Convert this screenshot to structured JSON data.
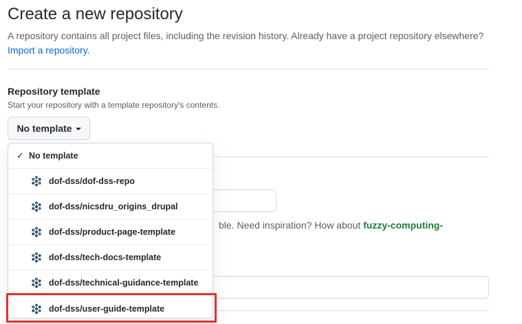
{
  "page": {
    "title": "Create a new repository",
    "description": "A repository contains all project files, including the revision history. Already have a project repository elsewhere?",
    "import_link": "Import a repository"
  },
  "template_section": {
    "label": "Repository template",
    "note": "Start your repository with a template repository's contents.",
    "button_label": "No template"
  },
  "background": {
    "inspiration_text": "ble. Need inspiration? How about ",
    "inspiration_suggestion": "fuzzy-computing-"
  },
  "menu": {
    "items": [
      {
        "label": "No template",
        "selected": true
      },
      {
        "label": "dof-dss/dof-dss-repo",
        "icon": "org-avatar-icon"
      },
      {
        "label": "dof-dss/nicsdru_origins_drupal",
        "icon": "org-avatar-icon"
      },
      {
        "label": "dof-dss/product-page-template",
        "icon": "org-avatar-icon"
      },
      {
        "label": "dof-dss/tech-docs-template",
        "icon": "org-avatar-icon"
      },
      {
        "label": "dof-dss/technical-guidance-template",
        "icon": "org-avatar-icon"
      },
      {
        "label": "dof-dss/user-guide-template",
        "icon": "org-avatar-icon",
        "highlighted": true
      }
    ]
  },
  "colors": {
    "link": "#0969da",
    "suggestion": "#1a7f37",
    "highlight_border": "#e5302a"
  }
}
